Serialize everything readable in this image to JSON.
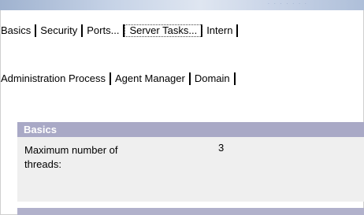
{
  "outer_tabs": [
    "Basics",
    "Security",
    "Ports...",
    "Server Tasks...",
    "Intern"
  ],
  "inner_tabs": [
    "Administration Process",
    "Agent Manager",
    "Domain"
  ],
  "section": {
    "title": "Basics",
    "field_label": "Maximum number of threads:",
    "field_value": "3"
  },
  "colors": {
    "section_header": "#a9a9c6",
    "section_body": "#efefef"
  }
}
